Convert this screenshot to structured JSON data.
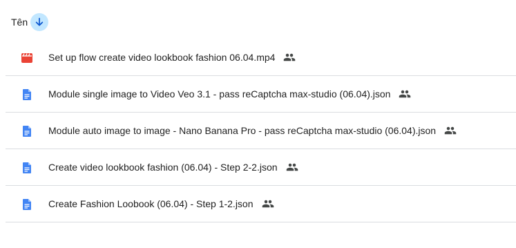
{
  "header": {
    "column_label": "Tên",
    "sort_icon": "arrow-down-icon",
    "sort_color": "#c2e7ff"
  },
  "files": [
    {
      "name": "Set up flow create video lookbook fashion 06.04.mp4",
      "type": "video",
      "icon": "video-file-icon",
      "icon_color": "#ea4335",
      "shared": true
    },
    {
      "name": "Module single image to Video Veo 3.1  - pass reCaptcha max-studio (06.04).json",
      "type": "document",
      "icon": "doc-file-icon",
      "icon_color": "#4285f4",
      "shared": true
    },
    {
      "name": "Module auto image to image - Nano Banana Pro - pass reCaptcha max-studio (06.04).json",
      "type": "document",
      "icon": "doc-file-icon",
      "icon_color": "#4285f4",
      "shared": true
    },
    {
      "name": "Create video lookbook fashion (06.04) - Step 2-2.json",
      "type": "document",
      "icon": "doc-file-icon",
      "icon_color": "#4285f4",
      "shared": true
    },
    {
      "name": "Create Fashion Loobook (06.04) - Step 1-2.json",
      "type": "document",
      "icon": "doc-file-icon",
      "icon_color": "#4285f4",
      "shared": true
    }
  ],
  "shared_icon": "people-icon"
}
